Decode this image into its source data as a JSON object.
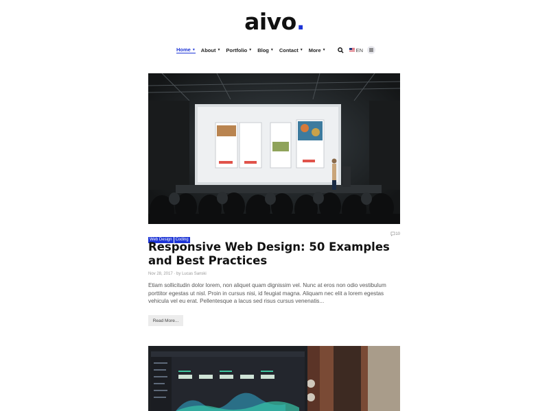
{
  "logo": {
    "text": "aivo",
    "dot": "."
  },
  "nav": {
    "items": [
      {
        "label": "Home",
        "active": true
      },
      {
        "label": "About",
        "active": false
      },
      {
        "label": "Portfolio",
        "active": false
      },
      {
        "label": "Blog",
        "active": false
      },
      {
        "label": "Contact",
        "active": false
      },
      {
        "label": "More",
        "active": false
      }
    ],
    "language": "EN"
  },
  "post": {
    "tags": [
      "Web Design",
      "Coding"
    ],
    "comments": "10",
    "title": "Responsive Web Design: 50 Examples and Best Practices",
    "date": "Nov 28, 2017",
    "by": "· by",
    "author": "Lucas Sanski",
    "excerpt": "Etiam sollicitudin dolor lorem, non aliquet quam dignissim vel. Nunc at eros non odio vestibulum porttitor egestas ut nisl. Proin in cursus nisi, id feugiat magna. Aliquam nec elit a lorem egestas vehicula vel eu erat. Pellentesque a lacus sed risus cursus venenatis...",
    "read_more": "Read More..."
  },
  "colors": {
    "accent": "#1d35d6",
    "text": "#111111",
    "muted": "#555555"
  }
}
